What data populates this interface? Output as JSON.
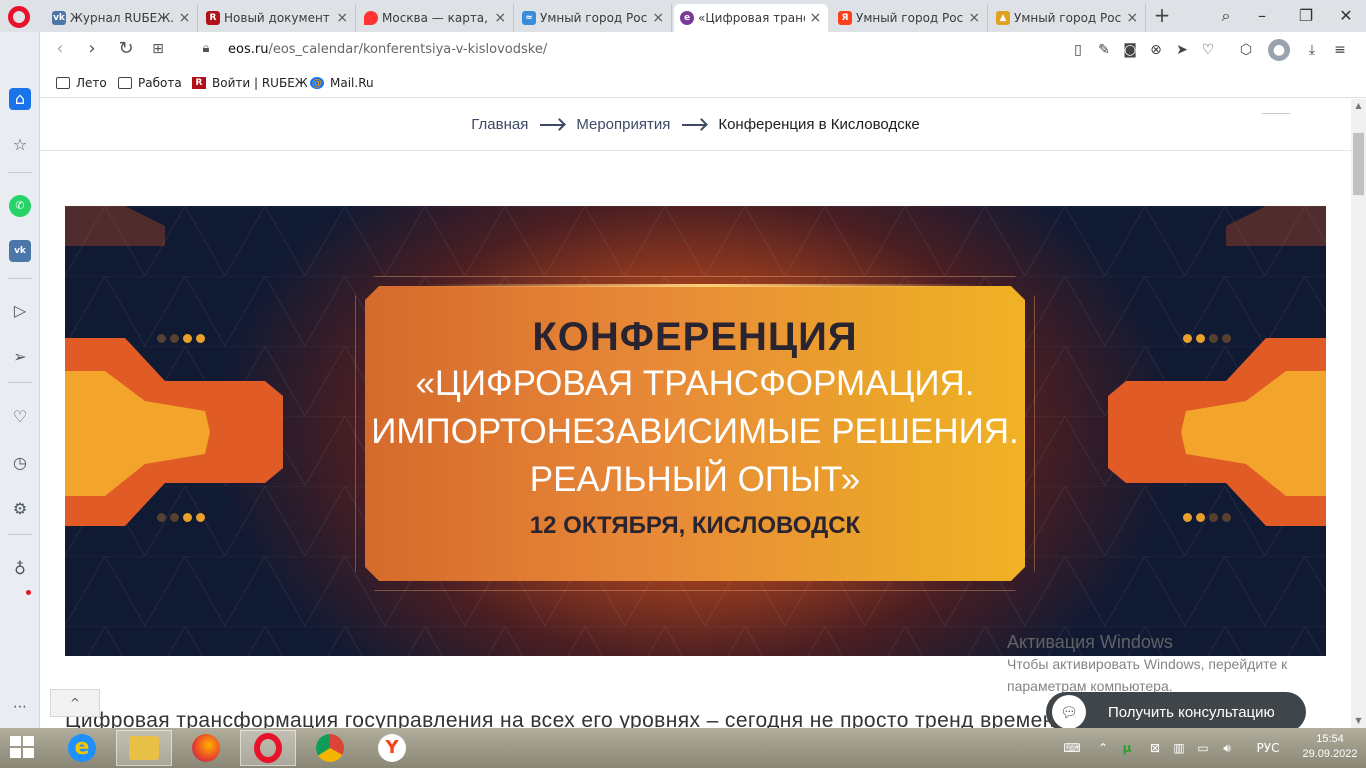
{
  "tabs": [
    {
      "title": "Журнал RUБЕЖ. Ак",
      "fav_color": "#4a76a8",
      "fav_glyph": "vk"
    },
    {
      "title": "Новый документ |",
      "fav_color": "#b0101a",
      "fav_glyph": "R"
    },
    {
      "title": "Москва — карта, ч",
      "fav_color": "#ff3333",
      "fav_glyph": "●"
    },
    {
      "title": "Умный город Роса",
      "fav_color": "#3a8bd8",
      "fav_glyph": "≈"
    },
    {
      "title": "«Цифровая трансф",
      "fav_color": "#7a3a9a",
      "fav_glyph": "e"
    },
    {
      "title": "Умный город Роса",
      "fav_color": "#fc3f1d",
      "fav_glyph": "Я"
    },
    {
      "title": "Умный город Роса",
      "fav_color": "#e0a020",
      "fav_glyph": "▲"
    }
  ],
  "active_tab": 4,
  "address": {
    "host": "eos.ru",
    "path": "/eos_calendar/konferentsiya-v-kislovodske/"
  },
  "bookmarks": [
    {
      "label": "Лето",
      "icon": "folder-icon"
    },
    {
      "label": "Работа",
      "icon": "folder-icon"
    },
    {
      "label": "Войти | RUБЕЖ",
      "icon": "rubezh-icon"
    },
    {
      "label": "Mail.Ru",
      "icon": "mailru-icon"
    }
  ],
  "breadcrumb": {
    "home": "Главная",
    "events": "Мероприятия",
    "current": "Конференция в Кисловодске"
  },
  "banner": {
    "title": "КОНФЕРЕНЦИЯ",
    "line1": "«ЦИФРОВАЯ ТРАНСФОРМАЦИЯ.",
    "line2": "ИМПОРТОНЕЗАВИСИМЫЕ РЕШЕНИЯ.",
    "line3": "РЕАЛЬНЫЙ ОПЫТ»",
    "date": "12 ОКТЯБРЯ, КИСЛОВОДСК"
  },
  "body_text": "Цифровая трансформация госуправления на всех его уровнях – сегодня не просто тренд времени, а фактор",
  "windows_activation": {
    "title": "Активация Windows",
    "subtitle": "Чтобы активировать Windows, перейдите к параметрам компьютера."
  },
  "consult_button": "Получить консультацию",
  "taskbar": {
    "lang": "РУС",
    "time": "15:54",
    "date": "29.09.2022"
  },
  "colors": {
    "accent": "#1a73e8",
    "banner_gold": "#f0b224",
    "banner_orange": "#d56a2c",
    "banner_navy": "#111a33"
  }
}
